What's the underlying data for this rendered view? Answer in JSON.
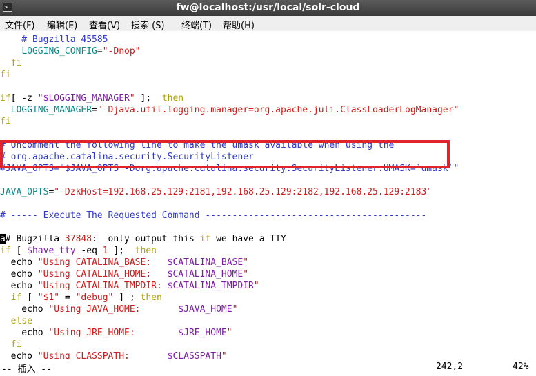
{
  "window": {
    "title": "fw@localhost:/usr/local/solr-cloud",
    "icon": "terminal-icon"
  },
  "menu": [
    "文件(F)",
    "编辑(E)",
    "查看(V)",
    "搜索 (S)",
    "终端(T)",
    "帮助(H)"
  ],
  "editor": {
    "lines": [
      [
        [
          "    # Bugzilla 45585",
          "c"
        ]
      ],
      [
        [
          "    ",
          "p"
        ],
        [
          "LOGGING_CONFIG",
          "i"
        ],
        [
          "=",
          "p"
        ],
        [
          "\"-Dnop\"",
          "s"
        ]
      ],
      [
        [
          "  fi",
          "k"
        ]
      ],
      [
        [
          "fi",
          "k"
        ]
      ],
      [],
      [
        [
          "if",
          "k"
        ],
        [
          "[ -z ",
          "p"
        ],
        [
          "\"",
          "s"
        ],
        [
          "$LOGGING_MANAGER",
          "v"
        ],
        [
          "\"",
          "s"
        ],
        [
          " ];  ",
          "p"
        ],
        [
          "then",
          "k"
        ]
      ],
      [
        [
          "  ",
          "p"
        ],
        [
          "LOGGING_MANAGER",
          "i"
        ],
        [
          "=",
          "p"
        ],
        [
          "\"-Djava.util.logging.manager=org.apache.juli.ClassLoaderLogManager\"",
          "s"
        ]
      ],
      [
        [
          "fi",
          "k"
        ]
      ],
      [],
      [
        [
          "# Uncomment the following line to make the umask available when using the",
          "c"
        ]
      ],
      [
        [
          "# org.apache.catalina.security.SecurityListener",
          "c"
        ]
      ],
      [
        [
          "#JAVA_OPTS=\"$JAVA_OPTS -Dorg.apache.catalina.security.SecurityListener.UMASK=`umask`\"",
          "c"
        ]
      ],
      [],
      [
        [
          "JAVA_OPTS",
          "i"
        ],
        [
          "=",
          "p"
        ],
        [
          "\"-DzkHost=192.168.25.129:2181,192.168.25.129:2182,192.168.25.129:2183\"",
          "s"
        ]
      ],
      [],
      [
        [
          "# ----- Execute The Requested Command -----------------------------------------",
          "c"
        ]
      ],
      [],
      [
        [
          "a",
          "cur"
        ],
        [
          "# Bugzilla ",
          "p"
        ],
        [
          "37848",
          "n"
        ],
        [
          ":  only output this ",
          "p"
        ],
        [
          "if",
          "k"
        ],
        [
          " we have a TTY",
          "p"
        ]
      ],
      [
        [
          "if",
          "k"
        ],
        [
          " [ ",
          "p"
        ],
        [
          "$have_tty",
          "v"
        ],
        [
          " -eq ",
          "p"
        ],
        [
          "1",
          "n"
        ],
        [
          " ];  ",
          "p"
        ],
        [
          "then",
          "k"
        ]
      ],
      [
        [
          "  echo ",
          "p"
        ],
        [
          "\"Using CATALINA_BASE:   ",
          "s"
        ],
        [
          "$CATALINA_BASE",
          "v"
        ],
        [
          "\"",
          "s"
        ]
      ],
      [
        [
          "  echo ",
          "p"
        ],
        [
          "\"Using CATALINA_HOME:   ",
          "s"
        ],
        [
          "$CATALINA_HOME",
          "v"
        ],
        [
          "\"",
          "s"
        ]
      ],
      [
        [
          "  echo ",
          "p"
        ],
        [
          "\"Using CATALINA_TMPDIR: ",
          "s"
        ],
        [
          "$CATALINA_TMPDIR",
          "v"
        ],
        [
          "\"",
          "s"
        ]
      ],
      [
        [
          "  if",
          "k"
        ],
        [
          " [ ",
          "p"
        ],
        [
          "\"$1\"",
          "s"
        ],
        [
          " = ",
          "p"
        ],
        [
          "\"debug\"",
          "s"
        ],
        [
          " ] ; ",
          "p"
        ],
        [
          "then",
          "k"
        ]
      ],
      [
        [
          "    echo ",
          "p"
        ],
        [
          "\"Using JAVA_HOME:       ",
          "s"
        ],
        [
          "$JAVA_HOME",
          "v"
        ],
        [
          "\"",
          "s"
        ]
      ],
      [
        [
          "  else",
          "k"
        ]
      ],
      [
        [
          "    echo ",
          "p"
        ],
        [
          "\"Using JRE_HOME:        ",
          "s"
        ],
        [
          "$JRE_HOME",
          "v"
        ],
        [
          "\"",
          "s"
        ]
      ],
      [
        [
          "  fi",
          "k"
        ]
      ],
      [
        [
          "  echo ",
          "p"
        ],
        [
          "\"Using CLASSPATH:       ",
          "s"
        ],
        [
          "$CLASSPATH",
          "v"
        ],
        [
          "\"",
          "s"
        ]
      ]
    ]
  },
  "status": {
    "mode": "-- 插入 --",
    "position": "242,2",
    "percent": "42%"
  },
  "colors": {
    "comment": "#2e39c8",
    "string": "#d11a1a",
    "keyword": "#b0a20a",
    "variable": "#7a1fa2",
    "identifier": "#0f8a8a",
    "highlight_box": "#e0242a"
  }
}
